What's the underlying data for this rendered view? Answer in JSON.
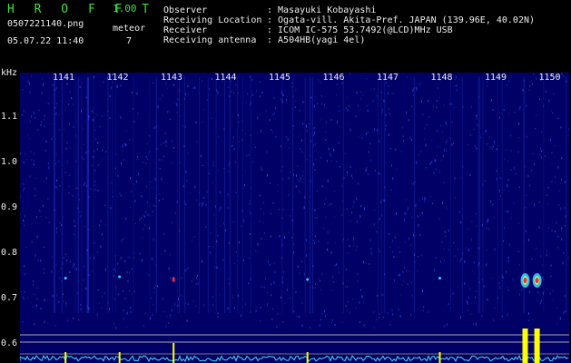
{
  "app": {
    "title": "H R O F F T",
    "version": "1.00"
  },
  "file": {
    "name": "0507221140.png",
    "datetime": "05.07.22 11:40"
  },
  "meteor": {
    "label": "meteor",
    "count": "7"
  },
  "info": [
    {
      "key": "Observer",
      "value": ": Masayuki Kobayashi"
    },
    {
      "key": "Receiving Location",
      "value": ": Ogata-vill. Akita-Pref. JAPAN (139.96E, 40.02N)"
    },
    {
      "key": "Receiver",
      "value": ": ICOM IC-575 53.7492(@LCD)MHz USB"
    },
    {
      "key": "Receiving antenna",
      "value": ": A504HB(yagi 4el)"
    }
  ],
  "colors": {
    "background": "#000066",
    "title": "#44dd44",
    "noise": "#3a5cff",
    "echo_strong": "#ff2244",
    "echo_mid": "#33ccff",
    "level_trace": "#44e0ee",
    "level_peak": "#ffff00"
  },
  "chart_data": {
    "type": "heatmap",
    "ylabel": "kHz",
    "y_ticks": [
      "1.1",
      "1.0",
      "0.9",
      "0.8",
      "0.7",
      "0.6"
    ],
    "y_tick_values": [
      1.1,
      1.0,
      0.9,
      0.8,
      0.7,
      0.6
    ],
    "x_ticks": [
      "1141",
      "1142",
      "1143",
      "1144",
      "1145",
      "1146",
      "1147",
      "1148",
      "1149",
      "1150"
    ],
    "x_tick_values": [
      1141,
      1142,
      1143,
      1144,
      1145,
      1146,
      1147,
      1148,
      1149,
      1150
    ],
    "echoes": [
      {
        "time": 1141.07,
        "freq": 0.745,
        "strength": "weak"
      },
      {
        "time": 1142.07,
        "freq": 0.748,
        "strength": "weak"
      },
      {
        "time": 1143.07,
        "freq": 0.742,
        "strength": "medium"
      },
      {
        "time": 1145.55,
        "freq": 0.742,
        "strength": "weak"
      },
      {
        "time": 1148.0,
        "freq": 0.745,
        "strength": "weak"
      },
      {
        "time": 1149.58,
        "freq": 0.74,
        "strength": "strong"
      },
      {
        "time": 1149.8,
        "freq": 0.74,
        "strength": "strong"
      }
    ]
  }
}
